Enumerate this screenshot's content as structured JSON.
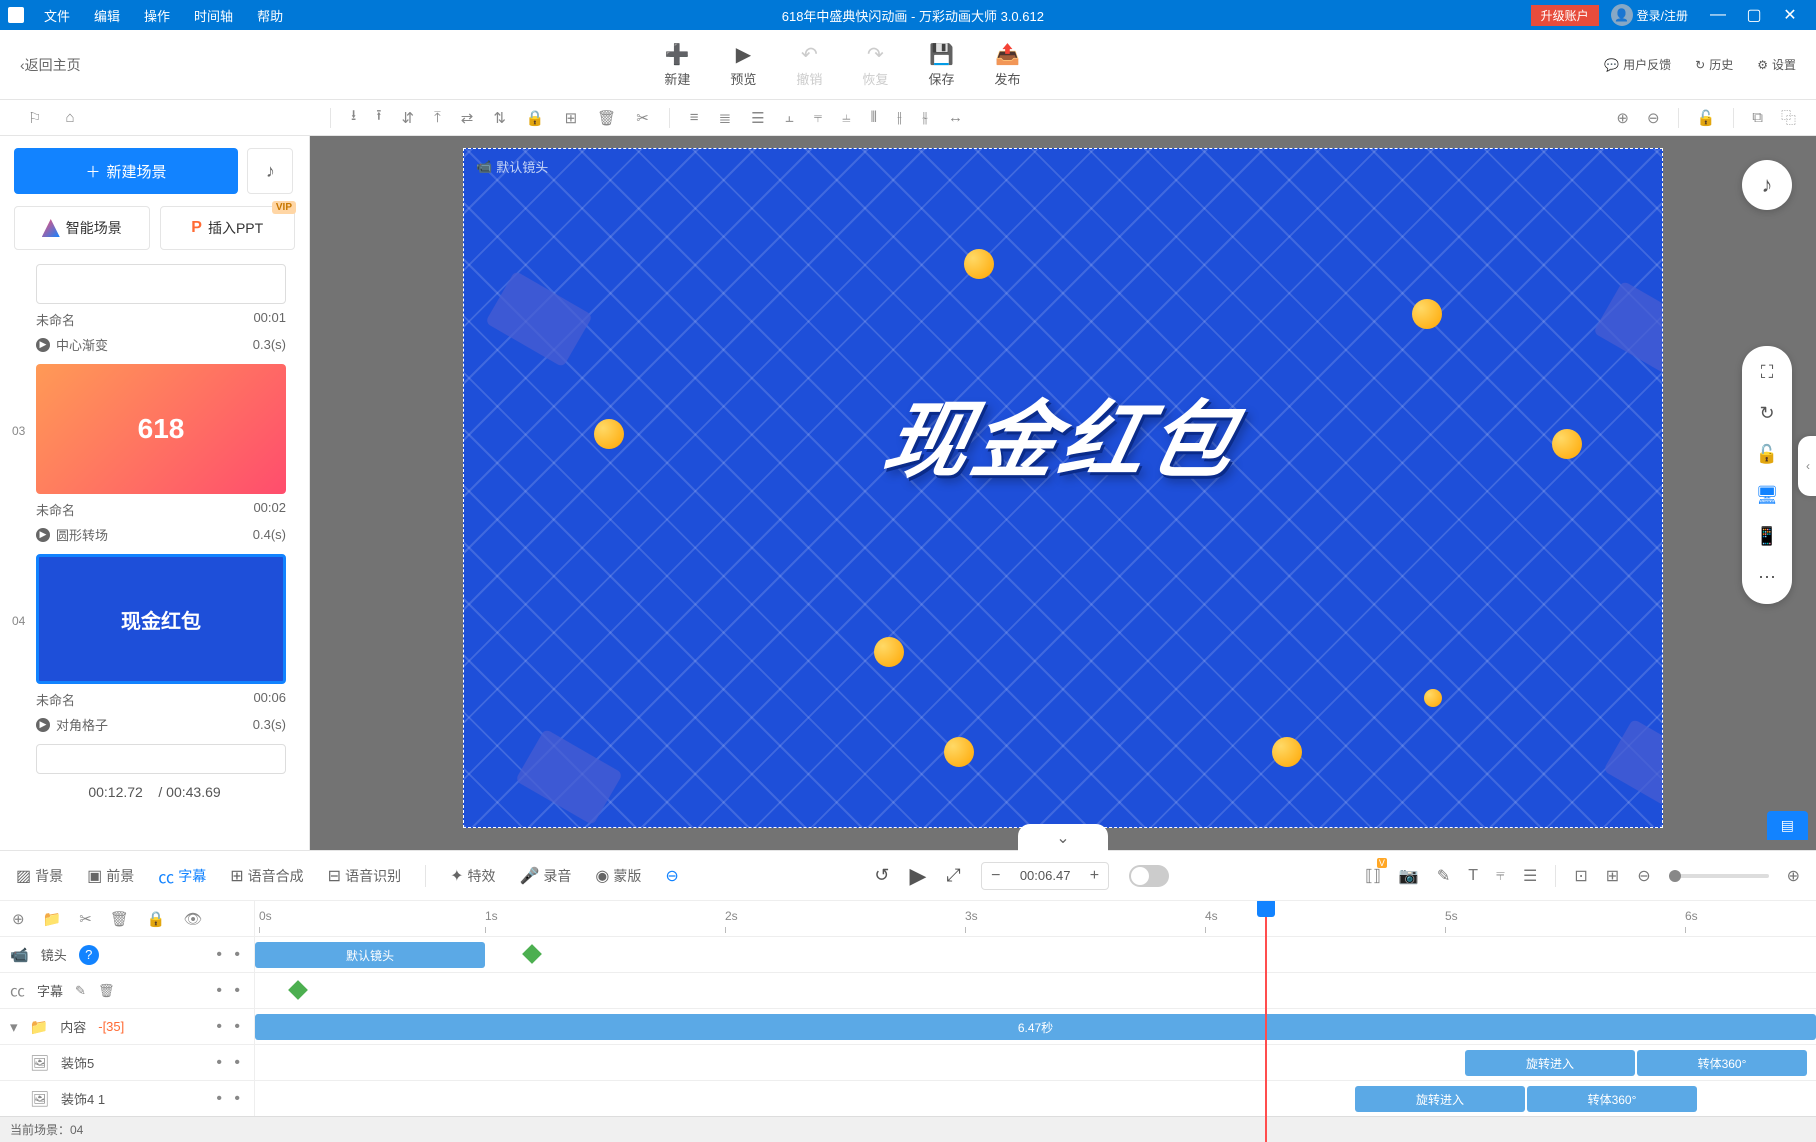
{
  "titlebar": {
    "menus": [
      "文件",
      "编辑",
      "操作",
      "时间轴",
      "帮助"
    ],
    "title": "618年中盛典快闪动画 - 万彩动画大师 3.0.612",
    "upgrade": "升级账户",
    "login": "登录/注册"
  },
  "toolbar": {
    "back": "返回主页",
    "actions": [
      {
        "icon": "＋",
        "label": "新建",
        "disabled": false
      },
      {
        "icon": "▶",
        "label": "预览",
        "disabled": false
      },
      {
        "icon": "↶",
        "label": "撤销",
        "disabled": true
      },
      {
        "icon": "↷",
        "label": "恢复",
        "disabled": true
      },
      {
        "icon": "💾",
        "label": "保存",
        "disabled": false
      },
      {
        "icon": "⤴",
        "label": "发布",
        "disabled": false
      }
    ],
    "right": [
      {
        "icon": "💬",
        "label": "用户反馈"
      },
      {
        "icon": "↻",
        "label": "历史"
      },
      {
        "icon": "⚙",
        "label": "设置"
      }
    ]
  },
  "leftPanel": {
    "newScene": "新建场景",
    "buttons": [
      {
        "label": "智能场景",
        "icon": "smart"
      },
      {
        "label": "插入PPT",
        "icon": "ppt",
        "vip": "VIP"
      }
    ],
    "scenes": [
      {
        "num": "",
        "name": "未命名",
        "time": "00:01",
        "trans": "中心渐变",
        "transTime": "0.3(s)",
        "thumb": "t1"
      },
      {
        "num": "03",
        "name": "未命名",
        "time": "00:02",
        "trans": "圆形转场",
        "transTime": "0.4(s)",
        "thumb": "t2",
        "thumbText": "618"
      },
      {
        "num": "04",
        "name": "未命名",
        "time": "00:06",
        "trans": "对角格子",
        "transTime": "0.3(s)",
        "thumb": "t3",
        "thumbText": "现金红包",
        "selected": true
      }
    ],
    "currentTime": "00:12.72",
    "totalTime": "/ 00:43.69"
  },
  "canvas": {
    "cameraLabel": "默认镜头",
    "mainText": "现金红包"
  },
  "timeline": {
    "tabs": [
      {
        "icon": "▨",
        "label": "背景"
      },
      {
        "icon": "▣",
        "label": "前景"
      },
      {
        "icon": "㏄",
        "label": "字幕",
        "active": true
      },
      {
        "icon": "⊞",
        "label": "语音合成"
      },
      {
        "icon": "⊟",
        "label": "语音识别"
      },
      {
        "icon": "✦",
        "label": "特效"
      },
      {
        "icon": "🎤",
        "label": "录音"
      },
      {
        "icon": "◉",
        "label": "蒙版"
      }
    ],
    "moreIcon": "⋯",
    "timeValue": "00:06.47",
    "ruler": [
      "0s",
      "1s",
      "2s",
      "3s",
      "4s",
      "5s",
      "6s"
    ],
    "tracks": {
      "camera": {
        "label": "镜头",
        "clipLabel": "默认镜头"
      },
      "subtitle": {
        "label": "字幕"
      },
      "content": {
        "label": "内容",
        "count": "-[35]",
        "clipText": "6.47秒"
      },
      "deco5": {
        "label": "装饰5",
        "anim1": "旋转进入",
        "anim2": "转体360°"
      },
      "deco41": {
        "label": "装饰4 1",
        "anim1": "旋转进入",
        "anim2": "转体360°"
      }
    }
  },
  "status": {
    "text": "当前场景：04"
  }
}
